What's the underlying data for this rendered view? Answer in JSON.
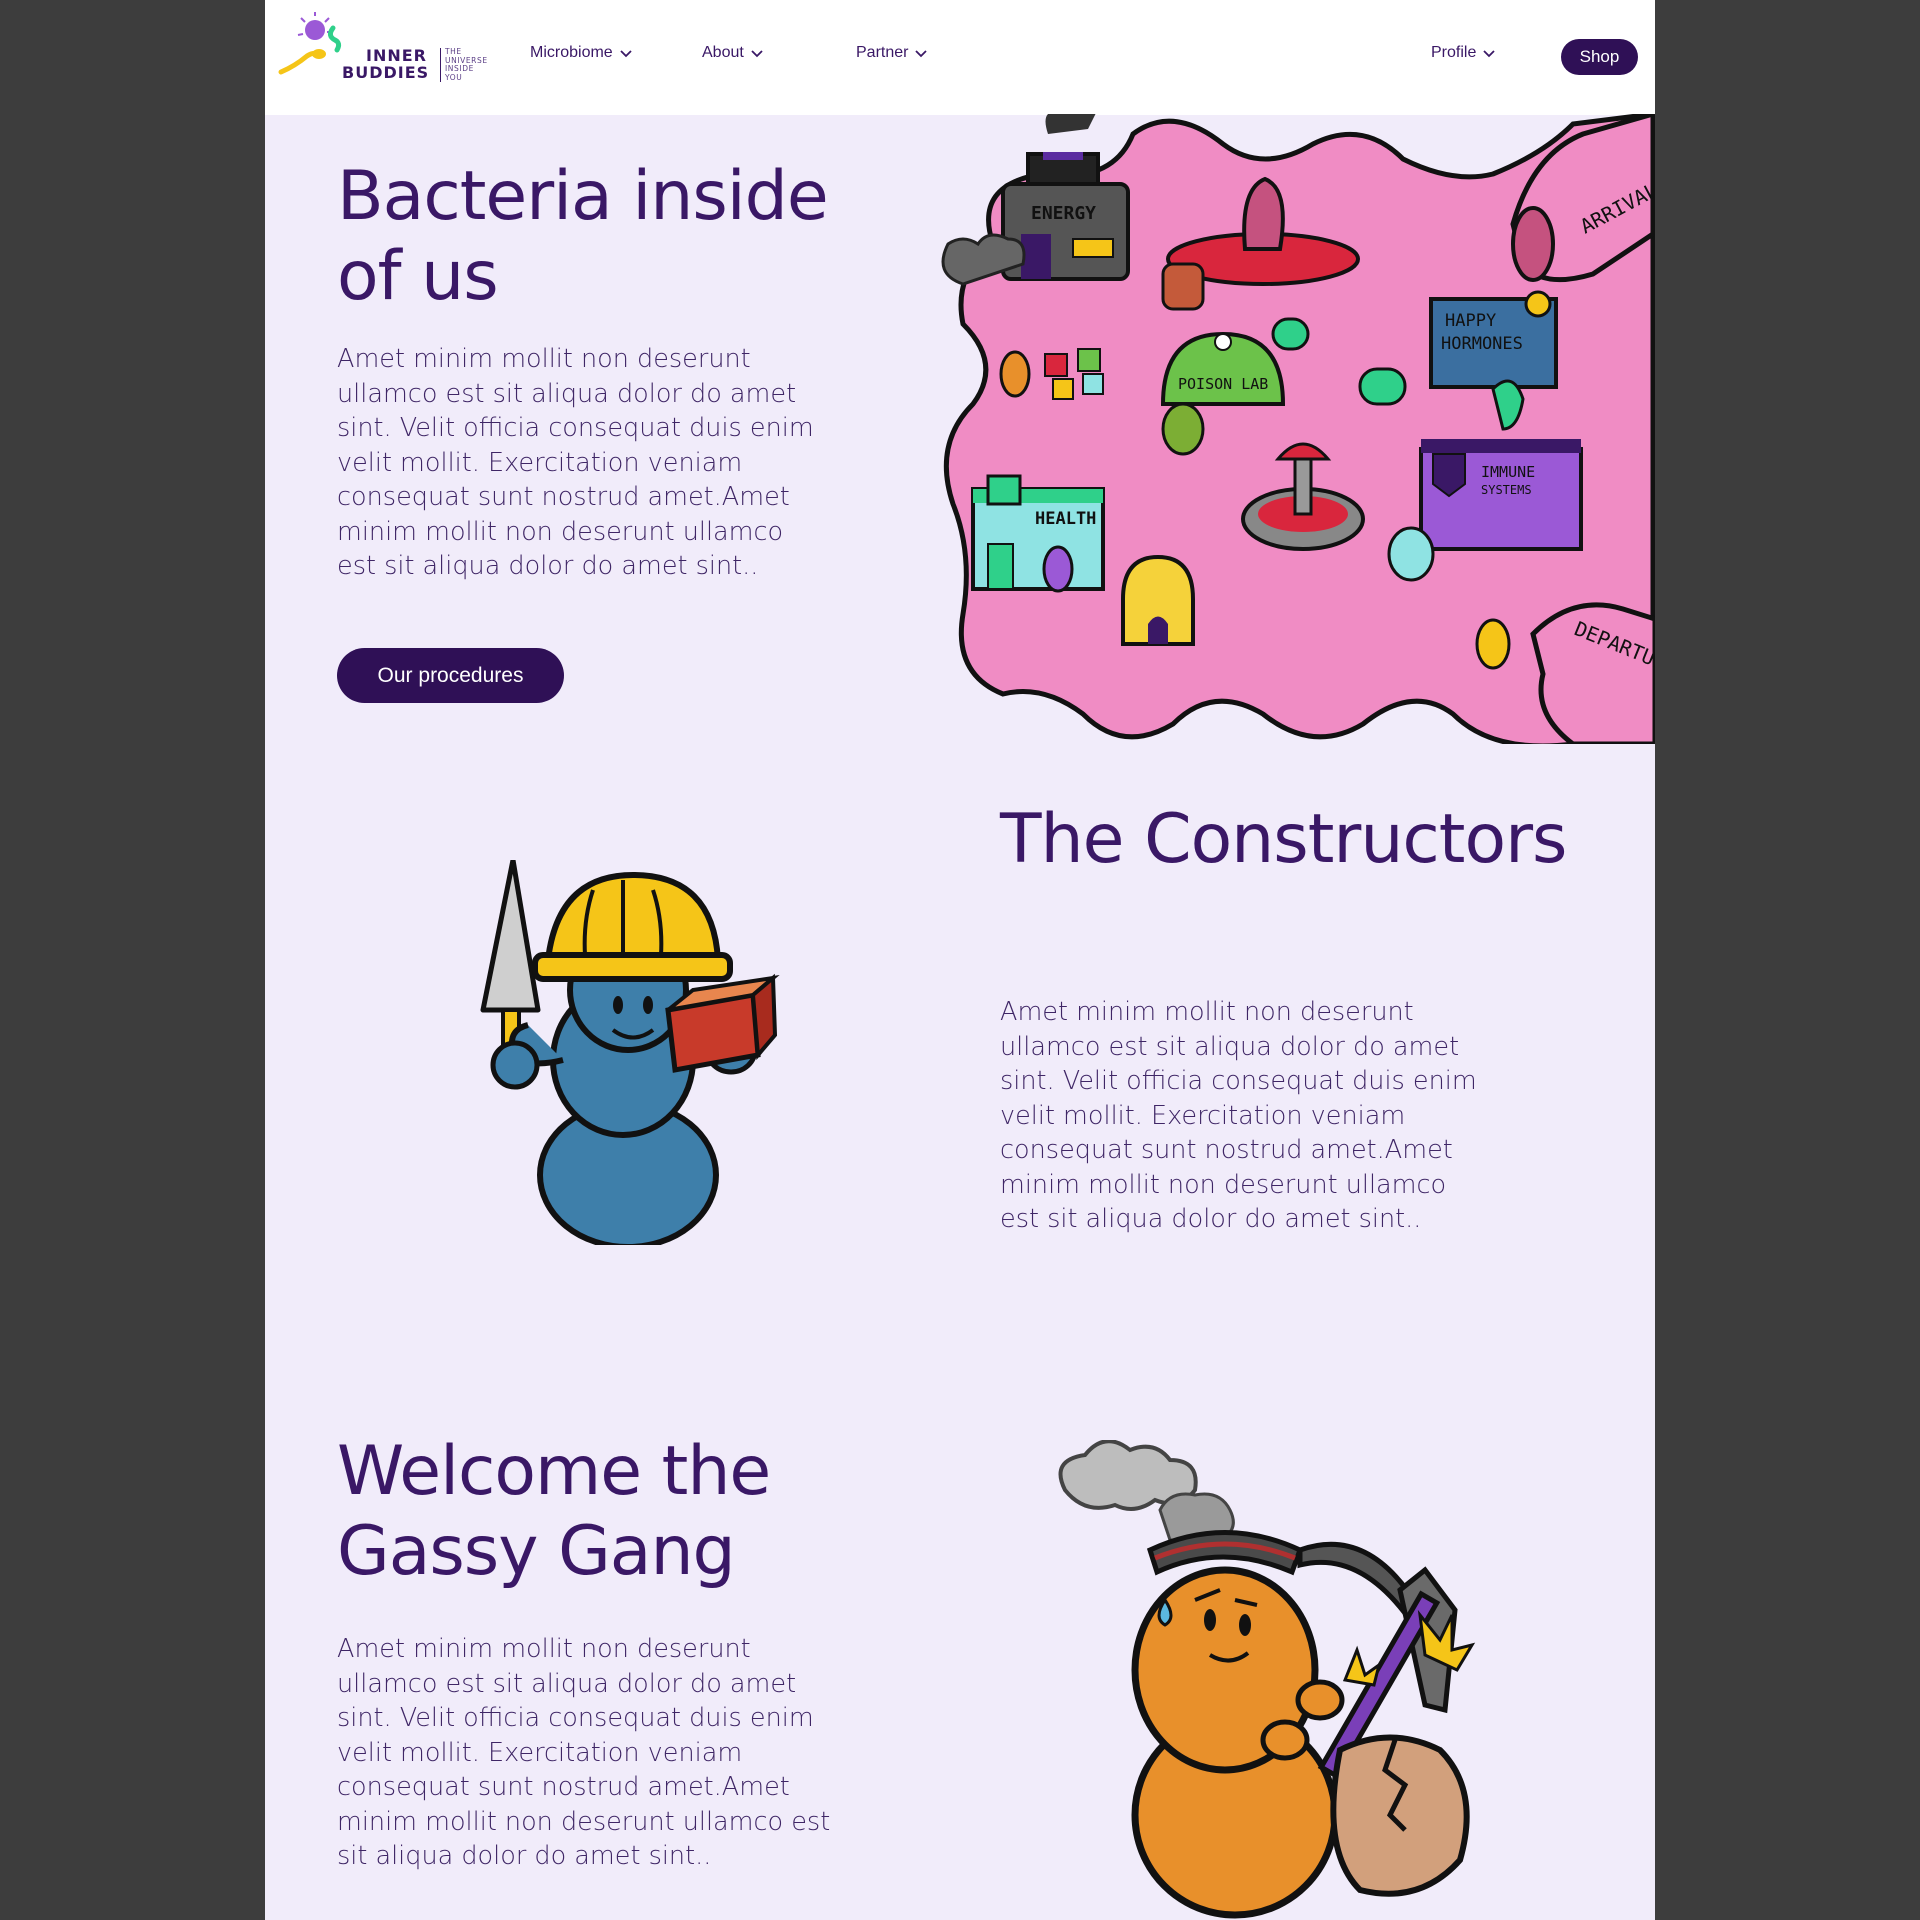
{
  "brand": {
    "name_line1": "INNER",
    "name_line2": "BUDDIES",
    "tagline": [
      "THE",
      "UNIVERSE",
      "INSIDE",
      "YOU"
    ]
  },
  "nav": {
    "items": [
      {
        "label": "Microbiome"
      },
      {
        "label": "About"
      },
      {
        "label": "Partner"
      }
    ],
    "profile_label": "Profile",
    "shop_label": "Shop"
  },
  "hero": {
    "title": "Bacteria inside of us",
    "body": "Amet minim mollit non deserunt ullamco est sit aliqua dolor do amet sint. Velit officia consequat duis enim velit mollit. Exercitation veniam consequat sunt nostrud amet.Amet minim mollit non deserunt ullamco est sit aliqua dolor do amet sint..",
    "cta_label": "Our procedures",
    "map_labels": {
      "energy": "ENERGY",
      "arrivals": "ARRIVALS",
      "happy_hormones": [
        "HAPPY",
        "HORMONES"
      ],
      "poison_lab": "POISON LAB",
      "immune_systems": [
        "IMMUNE",
        "SYSTEMS"
      ],
      "health": "HEALTH",
      "departures": "DEPARTURES"
    }
  },
  "constructors": {
    "title": "The Constructors",
    "body": "Amet minim mollit non deserunt ullamco est sit aliqua dolor do amet sint. Velit officia consequat duis enim velit mollit. Exercitation veniam consequat sunt nostrud amet.Amet minim mollit non deserunt ullamco est sit aliqua dolor do amet sint.."
  },
  "gassy": {
    "title": "Welcome the Gassy Gang",
    "body": "Amet minim mollit non deserunt ullamco est sit aliqua dolor do amet sint. Velit officia consequat duis enim velit mollit. Exercitation veniam consequat sunt nostrud amet.Amet minim mollit non deserunt ullamco est sit aliqua dolor do amet sint.."
  },
  "colors": {
    "brand_purple": "#3a1866",
    "button_purple": "#2f1056",
    "page_bg": "#f1ecfa",
    "gut_pink": "#f08cc4"
  }
}
